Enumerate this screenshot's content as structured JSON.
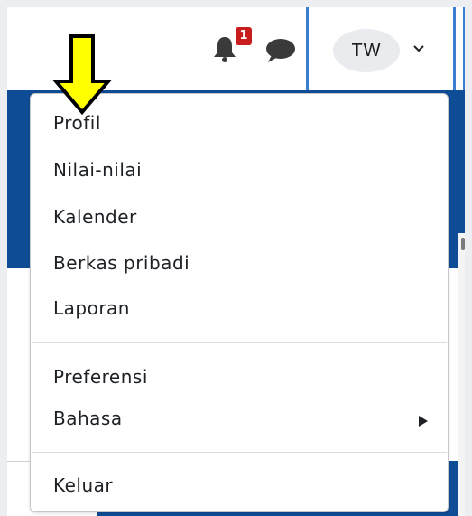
{
  "navbar": {
    "notification_count": "1",
    "avatar_initials": "TW",
    "icons": [
      "bell-icon",
      "chat-icon",
      "chevron-down-icon"
    ]
  },
  "annotation": {
    "arrow_color": "#ffff00",
    "icon": "arrow-down-icon"
  },
  "user_menu": {
    "items": [
      {
        "label": "Profil"
      },
      {
        "label": "Nilai-nilai"
      },
      {
        "label": "Kalender"
      },
      {
        "label": "Berkas pribadi"
      },
      {
        "label": "Laporan"
      },
      {
        "label": "Preferensi"
      },
      {
        "label": "Bahasa",
        "has_submenu": true
      },
      {
        "label": "Keluar"
      }
    ]
  },
  "colors": {
    "brand_blue": "#0f4c96",
    "badge_red": "#c81d1d",
    "focus_blue": "#3a7fd0"
  }
}
